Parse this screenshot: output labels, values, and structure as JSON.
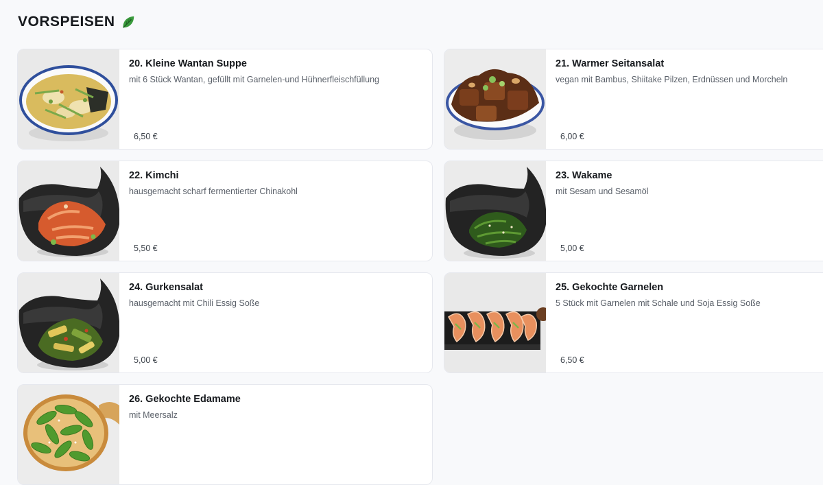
{
  "section": {
    "title": "VORSPEISEN",
    "title_icon": "leaf-icon",
    "accent_color": "#3a9b3c"
  },
  "items": [
    {
      "name": "20. Kleine Wantan Suppe",
      "description": "mit 6 Stück Wantan, gefüllt mit Garnelen-und Hühnerfleischfüllung",
      "price": "6,50 €",
      "image": "wonton-soup-image"
    },
    {
      "name": "21. Warmer Seitansalat",
      "description": "vegan mit Bambus, Shiitake Pilzen, Erdnüssen und Morcheln",
      "price": "6,00 €",
      "image": "seitan-salad-image"
    },
    {
      "name": "22. Kimchi",
      "description": "hausgemacht scharf fermentierter Chinakohl",
      "price": "5,50 €",
      "image": "kimchi-image"
    },
    {
      "name": "23. Wakame",
      "description": "mit Sesam und Sesamöl",
      "price": "5,00 €",
      "image": "wakame-image"
    },
    {
      "name": "24. Gurkensalat",
      "description": "hausgemacht mit Chili Essig Soße",
      "price": "5,00 €",
      "image": "cucumber-salad-image"
    },
    {
      "name": "25. Gekochte Garnelen",
      "description": "5 Stück mit Garnelen mit Schale und Soja Essig Soße",
      "price": "6,50 €",
      "image": "shrimp-image"
    },
    {
      "name": "26. Gekochte Edamame",
      "description": "mit Meersalz",
      "price": "",
      "image": "edamame-image"
    }
  ]
}
